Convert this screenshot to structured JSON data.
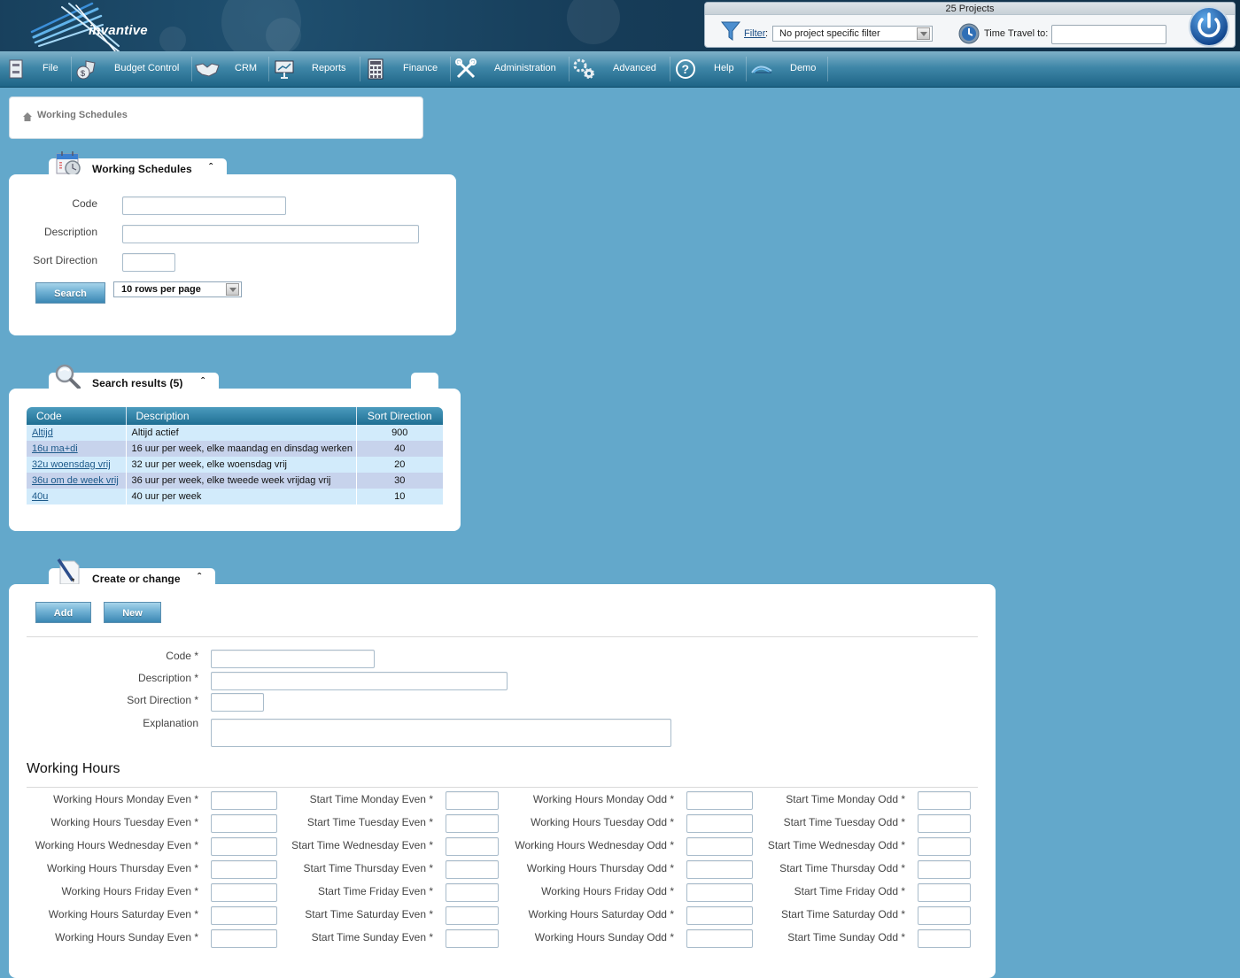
{
  "header": {
    "brand": "invantive",
    "projects_count": "25 Projects",
    "filter_label": "Filter",
    "filter_colon": ":",
    "filter_value": "No project specific filter",
    "time_travel_label": "Time Travel to:",
    "time_travel_value": ""
  },
  "nav": {
    "items": [
      {
        "label": "File",
        "icon": "file-cabinet-icon"
      },
      {
        "label": "Budget Control",
        "icon": "money-bag-icon"
      },
      {
        "label": "CRM",
        "icon": "handshake-icon"
      },
      {
        "label": "Reports",
        "icon": "presentation-icon"
      },
      {
        "label": "Finance",
        "icon": "calculator-icon"
      },
      {
        "label": "Administration",
        "icon": "tools-icon"
      },
      {
        "label": "Advanced",
        "icon": "gears-icon"
      },
      {
        "label": "Help",
        "icon": "help-icon"
      },
      {
        "label": "Demo",
        "icon": "demo-logo-icon"
      }
    ]
  },
  "breadcrumb": {
    "current": "Working Schedules"
  },
  "search_panel": {
    "title": "Working Schedules",
    "collapse": "≈",
    "fields": {
      "code_label": "Code",
      "code_value": "",
      "description_label": "Description",
      "description_value": "",
      "sort_label": "Sort Direction",
      "sort_value": ""
    },
    "search_button": "Search",
    "rows_per_page": "10 rows per page"
  },
  "results_panel": {
    "title": "Search results (5)",
    "columns": [
      "Code",
      "Description",
      "Sort Direction"
    ],
    "rows": [
      {
        "code": "Altijd",
        "description": "Altijd actief",
        "sort": "900"
      },
      {
        "code": "16u ma+di",
        "description": "16 uur per week, elke maandag en dinsdag werken",
        "sort": "40"
      },
      {
        "code": "32u woensdag vrij",
        "description": "32 uur per week, elke woensdag vrij",
        "sort": "20"
      },
      {
        "code": "36u om de week vrij",
        "description": "36 uur per week, elke tweede week vrijdag vrij",
        "sort": "30"
      },
      {
        "code": "40u",
        "description": "40 uur per week",
        "sort": "10"
      }
    ]
  },
  "edit_panel": {
    "title": "Create or change",
    "add_button": "Add",
    "new_button": "New",
    "fields": {
      "code_label": "Code *",
      "description_label": "Description *",
      "sort_label": "Sort Direction *",
      "explanation_label": "Explanation"
    },
    "working_hours_title": "Working Hours",
    "working_hours_rows": [
      {
        "wh_even": "Working Hours Monday Even *",
        "st_even": "Start Time Monday Even *",
        "wh_odd": "Working Hours Monday Odd *",
        "st_odd": "Start Time Monday Odd *"
      },
      {
        "wh_even": "Working Hours Tuesday Even *",
        "st_even": "Start Time Tuesday Even *",
        "wh_odd": "Working Hours Tuesday Odd *",
        "st_odd": "Start Time Tuesday Odd *"
      },
      {
        "wh_even": "Working Hours Wednesday Even *",
        "st_even": "Start Time Wednesday Even *",
        "wh_odd": "Working Hours Wednesday Odd *",
        "st_odd": "Start Time Wednesday Odd *"
      },
      {
        "wh_even": "Working Hours Thursday Even *",
        "st_even": "Start Time Thursday Even *",
        "wh_odd": "Working Hours Thursday Odd *",
        "st_odd": "Start Time Thursday Odd *"
      },
      {
        "wh_even": "Working Hours Friday Even *",
        "st_even": "Start Time Friday Even *",
        "wh_odd": "Working Hours Friday Odd *",
        "st_odd": "Start Time Friday Odd *"
      },
      {
        "wh_even": "Working Hours Saturday Even *",
        "st_even": "Start Time Saturday Even *",
        "wh_odd": "Working Hours Saturday Odd *",
        "st_odd": "Start Time Saturday Odd *"
      },
      {
        "wh_even": "Working Hours Sunday Even *",
        "st_even": "Start Time Sunday Even *",
        "wh_odd": "Working Hours Sunday Odd *",
        "st_odd": "Start Time Sunday Odd *"
      }
    ]
  },
  "colors": {
    "page_background": "#63a8cb",
    "header_dark": "#163c58",
    "nav_gradient_top": "#7fb1c9",
    "nav_gradient_bottom": "#1e6486",
    "table_header": "#2f82a8",
    "row_light": "#d2ebfb",
    "row_alt": "#c7d3ec",
    "link": "#1d5a8a"
  }
}
